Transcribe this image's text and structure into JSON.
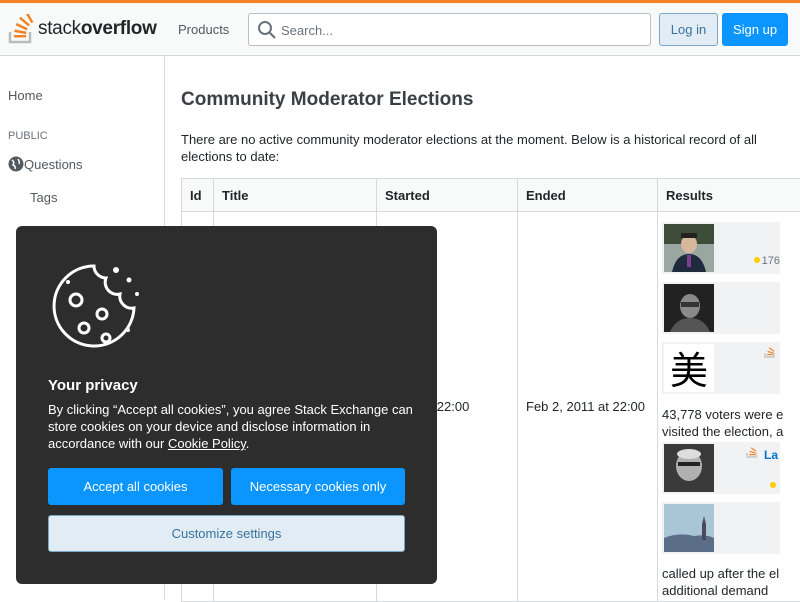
{
  "header": {
    "logo_light": "stack",
    "logo_bold": "overflow",
    "products_label": "Products",
    "search_placeholder": "Search...",
    "login_label": "Log in",
    "signup_label": "Sign up",
    "accent_color": "#f48225"
  },
  "sidebar": {
    "home_label": "Home",
    "public_label": "PUBLIC",
    "questions_label": "Questions",
    "tags_label": "Tags"
  },
  "main": {
    "title": "Community Moderator Elections",
    "intro": "There are no active community moderator elections at the moment. Below is a historical record of all elections to date:",
    "table": {
      "headers": [
        "Id",
        "Title",
        "Started",
        "Ended",
        "Results"
      ],
      "rows": [
        {
          "started": "…011 at 22:00",
          "ended": "Feb 2, 2011 at 22:00",
          "result_rep": "176",
          "result_text_1": "43,778 voters were e",
          "result_text_2": "visited the election, a",
          "result_link": "La",
          "result_text_3": "called up after the el",
          "result_text_4": "additional demand"
        }
      ]
    }
  },
  "cookie_banner": {
    "title": "Your privacy",
    "body_before_link": "By clicking “Accept all cookies”, you agree Stack Exchange can store cookies on your device and disclose information in accordance with our ",
    "link_text": "Cookie Policy",
    "body_after_link": ".",
    "accept_label": "Accept all cookies",
    "necessary_label": "Necessary cookies only",
    "customize_label": "Customize settings"
  }
}
